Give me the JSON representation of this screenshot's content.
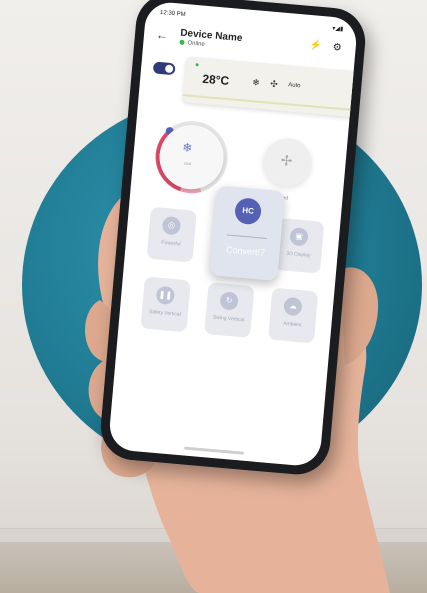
{
  "status": {
    "time": "12:30 PM",
    "icons": "▾◢▮"
  },
  "header": {
    "back_icon": "arrow-left-icon",
    "title": "Device Name",
    "status_text": "Online",
    "action_icons": [
      "bolt-icon",
      "gear-icon"
    ]
  },
  "ac": {
    "temperature": "28°C",
    "mode_icon_1": "snowflake-icon",
    "mode_icon_2": "fan-icon",
    "mode": "Auto"
  },
  "controls": {
    "dial_icon": "snowflake-icon",
    "dial_sub": "cool",
    "fan_label": "Fan speed"
  },
  "tiles": [
    {
      "label": "Powerful"
    },
    {
      "label": "3D Display"
    },
    {
      "label": "Safety Vertical"
    },
    {
      "label": "Swing Vertical"
    },
    {
      "label": "Ambient"
    }
  ],
  "popup": {
    "badge": "HC",
    "label": "Convert!7"
  },
  "colors": {
    "accent": "#5562b4",
    "online": "#3bb54a",
    "circle": "#1f7a92"
  }
}
